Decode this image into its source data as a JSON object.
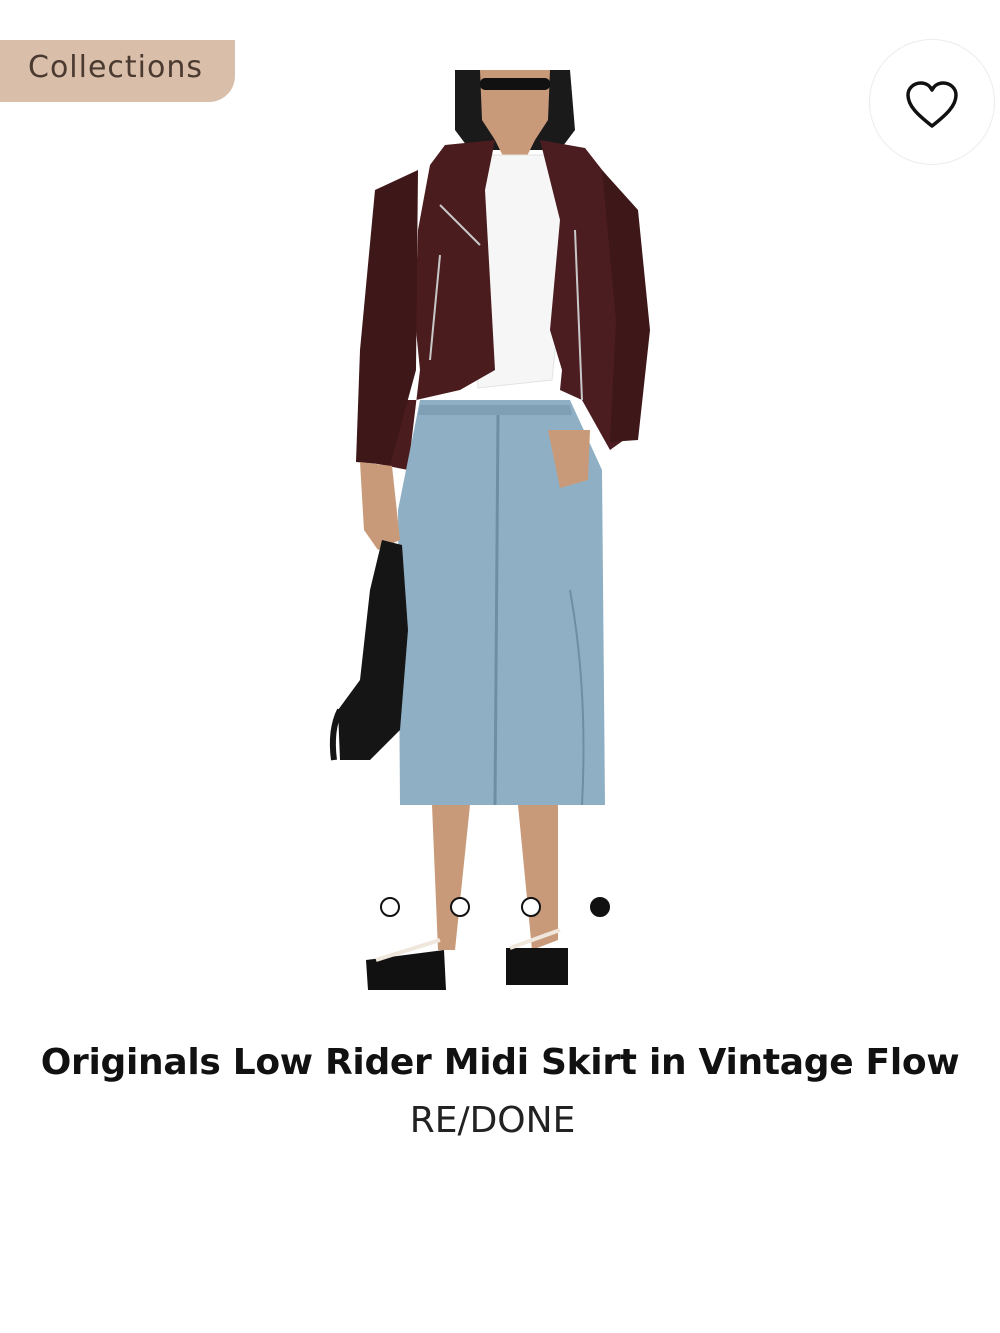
{
  "header": {
    "collections_label": "Collections"
  },
  "product": {
    "title": "Originals Low Rider Midi Skirt in Vintage Flow",
    "brand": "RE/DONE",
    "favorite_icon": "heart-outline-icon"
  },
  "carousel": {
    "total": 4,
    "active_index": 4
  },
  "colors": {
    "pill_background": "#d9bfaa",
    "text_primary": "#111111"
  }
}
